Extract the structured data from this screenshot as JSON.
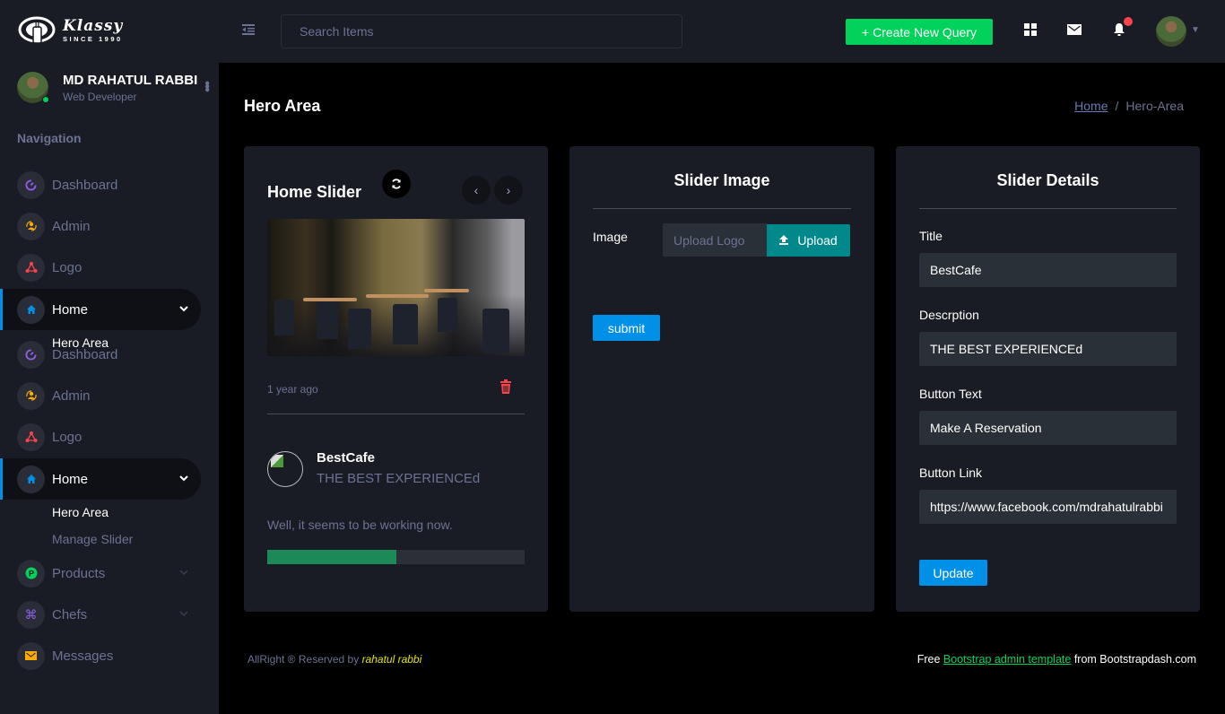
{
  "brand": {
    "name": "Klassy",
    "tagline": "SINCE 1990"
  },
  "profile": {
    "name": "MD RAHATUL RABBI",
    "role": "Web Developer",
    "status": "online"
  },
  "sidebar": {
    "category": "Navigation",
    "items": [
      {
        "label": "Dashboard",
        "icon": "speedometer-icon",
        "color": "#8f5fe8"
      },
      {
        "label": "Admin",
        "icon": "account-icon",
        "color": "#ffab00"
      },
      {
        "label": "Logo",
        "icon": "network-icon",
        "color": "#fc424a"
      },
      {
        "label": "Home",
        "icon": "home-icon",
        "color": "#0090e7",
        "active": true,
        "submenu": [
          "Hero Area"
        ]
      },
      {
        "label": "Dashboard",
        "icon": "speedometer-icon",
        "color": "#8f5fe8"
      },
      {
        "label": "Admin",
        "icon": "account-icon",
        "color": "#ffab00"
      },
      {
        "label": "Logo",
        "icon": "network-icon",
        "color": "#fc424a"
      },
      {
        "label": "Home",
        "icon": "home-icon",
        "color": "#0090e7",
        "active": true,
        "submenu": [
          "Hero Area",
          "Manage Slider"
        ]
      },
      {
        "label": "Products",
        "icon": "product-icon",
        "color": "#00d25b"
      },
      {
        "label": "Chefs",
        "icon": "command-icon",
        "color": "#8f5fe8"
      },
      {
        "label": "Messages",
        "icon": "mail-icon",
        "color": "#ffab00"
      }
    ],
    "overlay_sub": "Hero Area",
    "sub_hero": "Hero Area",
    "sub_manage": "Manage Slider"
  },
  "topbar": {
    "search_placeholder": "Search Items",
    "create_label": "+ Create New Query",
    "icons": [
      "grid-icon",
      "mail-icon",
      "bell-icon"
    ]
  },
  "page": {
    "title": "Hero Area",
    "breadcrumb": {
      "home": "Home",
      "sep": "/",
      "current": "Hero-Area"
    }
  },
  "home_slider": {
    "title": "Home Slider",
    "time": "1 year ago",
    "item_title": "BestCafe",
    "item_desc": "THE BEST EXPERIENCEd",
    "status_text": "Well, it seems to be working now.",
    "progress_percent": 50
  },
  "slider_image": {
    "title": "Slider Image",
    "image_label": "Image",
    "upload_placeholder": "Upload Logo",
    "upload_label": "Upload",
    "submit_label": "submit"
  },
  "slider_details": {
    "title": "Slider Details",
    "fields": [
      {
        "label": "Title",
        "value": "BestCafe"
      },
      {
        "label": "Descrption",
        "value": "THE BEST EXPERIENCEd"
      },
      {
        "label": "Button Text",
        "value": "Make A Reservation"
      },
      {
        "label": "Button Link",
        "value": "https://www.facebook.com/mdrahatulrabbi"
      }
    ],
    "update_label": "Update"
  },
  "footer": {
    "left_text": "AllRight ® Reserved by ",
    "left_author": "rahatul rabbi",
    "right_pre": "Free ",
    "right_link": "Bootstrap admin template",
    "right_post": " from Bootstrapdash.com"
  }
}
